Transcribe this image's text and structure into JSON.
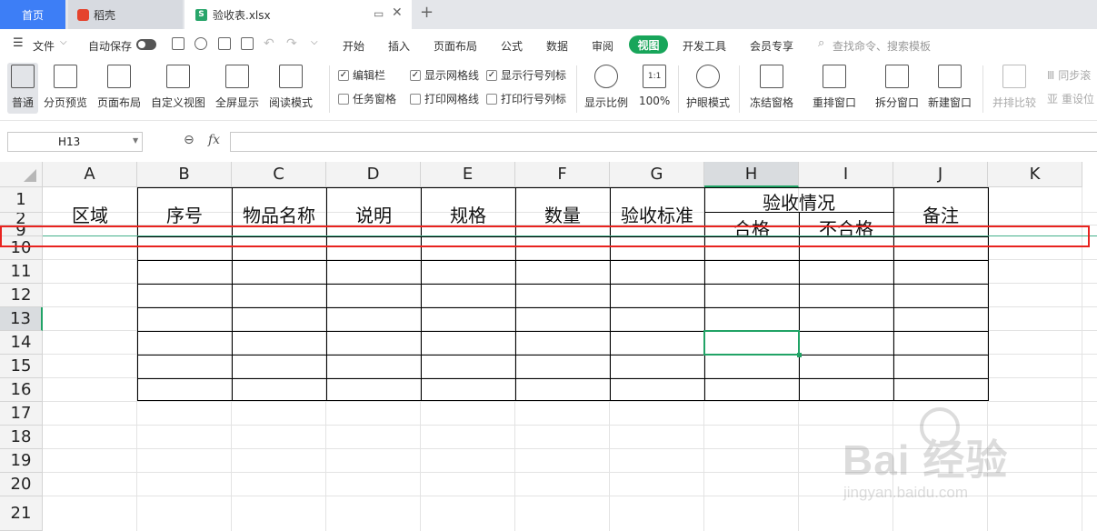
{
  "tabs": {
    "home": "首页",
    "daoke": "稻壳",
    "file": "验收表.xlsx",
    "file_icon": "S",
    "new": "+"
  },
  "menu": {
    "file": "文件",
    "autosave": "自动保存",
    "items": [
      "开始",
      "插入",
      "页面布局",
      "公式",
      "数据",
      "审阅",
      "视图",
      "开发工具",
      "会员专享"
    ],
    "search_placeholder": "查找命令、搜索模板"
  },
  "ribbon": {
    "normal": "普通",
    "page_break": "分页预览",
    "page_layout": "页面布局",
    "custom_view": "自定义视图",
    "fullscreen": "全屏显示",
    "reading": "阅读模式",
    "chk_formula_bar": "编辑栏",
    "chk_gridlines": "显示网格线",
    "chk_headings": "显示行号列标",
    "chk_task_pane": "任务窗格",
    "chk_print_grid": "打印网格线",
    "chk_print_headings": "打印行号列标",
    "zoom_ratio": "显示比例",
    "zoom_100": "100%",
    "zoom_100_icon": "1:1",
    "eye_mode": "护眼模式",
    "freeze": "冻结窗格",
    "arrange": "重排窗口",
    "split": "拆分窗口",
    "new_window": "新建窗口",
    "side_by_side": "并排比较",
    "sync_scroll": "同步滚",
    "reset_pos": "重设位"
  },
  "formula_bar": {
    "name_box": "H13",
    "fx": "fx",
    "formula": ""
  },
  "columns": [
    "A",
    "B",
    "C",
    "D",
    "E",
    "F",
    "G",
    "H",
    "I",
    "J",
    "K"
  ],
  "rows": [
    "1",
    "2",
    "9",
    "10",
    "11",
    "12",
    "13",
    "14",
    "15",
    "16",
    "17",
    "18",
    "19",
    "20",
    "21"
  ],
  "table": {
    "region": "区域",
    "seq": "序号",
    "item_name": "物品名称",
    "desc": "说明",
    "spec": "规格",
    "qty": "数量",
    "standard": "验收标准",
    "status": "验收情况",
    "pass": "合格",
    "fail": "不合格",
    "remark": "备注"
  },
  "watermark": {
    "logo": "Bai  经验",
    "url": "jingyan.baidu.com"
  },
  "colors": {
    "accent_green": "#21a366",
    "tab_blue": "#3d7ef6",
    "highlight_red": "#e8231f"
  }
}
